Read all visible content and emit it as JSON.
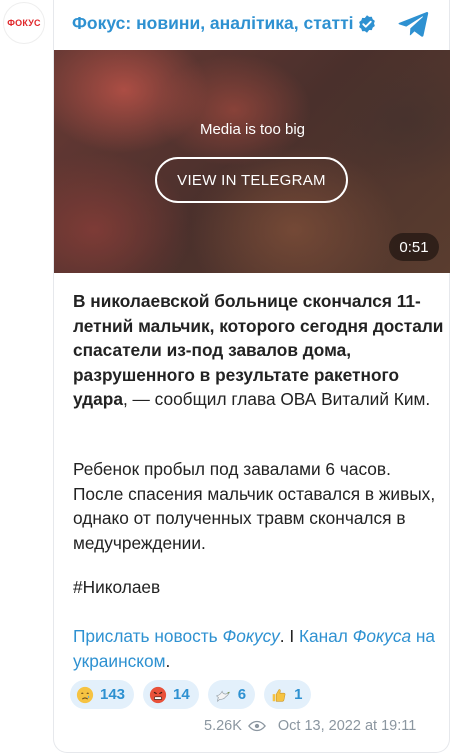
{
  "avatar": {
    "label": "ФОКУС"
  },
  "header": {
    "channel_title": "Фокус: новини, аналітика, статті",
    "verified": "verified-icon",
    "logo": "telegram-icon"
  },
  "media": {
    "message": "Media is too big",
    "button_label": "VIEW IN TELEGRAM",
    "duration": "0:51"
  },
  "post": {
    "p1_bold": "В николаевской больнице скончался 11-летний мальчик, которого сегодня достали спасатели из-под завалов дома, разрушенного в результате ракетного удара",
    "p1_rest": ", — сообщил глава ОВА Виталий Ким.",
    "p2": "Ребенок пробыл под завалами 6 часов. После спасения мальчик оставался в живых, однако от полученных травм скончался в медучреждении.",
    "p3": "#Николаев",
    "p4_link1": "Прислать новость ",
    "p4_link1_italic": "Фокусу",
    "p4_sep": ". І ",
    "p4_link2": "Канал ",
    "p4_link2_italic": "Фокуса",
    "p4_link2_rest": " на украинском",
    "p4_end": "."
  },
  "reactions": [
    {
      "emoji": "crying-face-icon",
      "count": "143",
      "color": "#f6c342"
    },
    {
      "emoji": "angry-face-icon",
      "count": "14",
      "color": "#e8513a"
    },
    {
      "emoji": "dove-icon",
      "count": "6",
      "color": "#f0f0f0"
    },
    {
      "emoji": "thumbs-up-icon",
      "count": "1",
      "color": "#f6c342"
    }
  ],
  "meta": {
    "views": "5.26K",
    "date": "Oct 13, 2022 at 19:11"
  },
  "colors": {
    "accent": "#2e91d1",
    "reaction_bg": "#e3f0fb",
    "meta": "#8b96a0"
  }
}
